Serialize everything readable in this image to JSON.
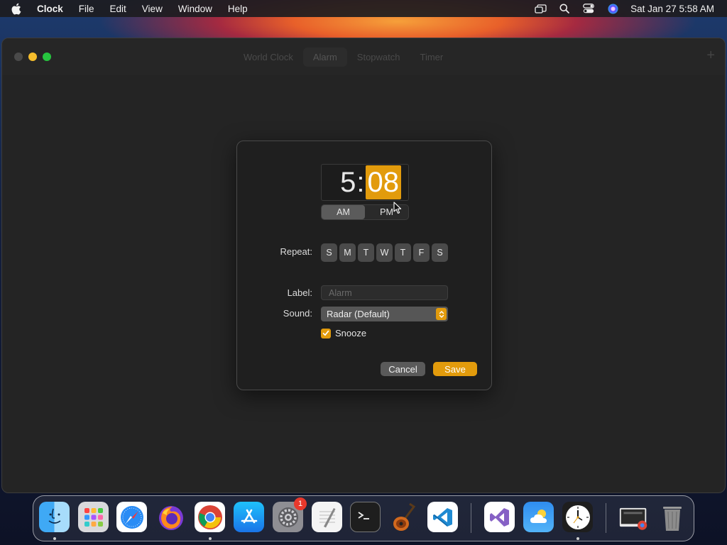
{
  "menubar": {
    "app_name": "Clock",
    "menus": [
      "File",
      "Edit",
      "View",
      "Window",
      "Help"
    ],
    "clock": "Sat Jan 27  5:58 AM"
  },
  "window": {
    "tabs": [
      "World Clock",
      "Alarm",
      "Stopwatch",
      "Timer"
    ],
    "active_tab": "Alarm",
    "add_label": "+"
  },
  "dialog": {
    "time": {
      "hours": "5",
      "separator": ":",
      "minutes": "08"
    },
    "ampm": {
      "am": "AM",
      "pm": "PM",
      "selected": "AM"
    },
    "repeat": {
      "label": "Repeat:",
      "days": [
        "S",
        "M",
        "T",
        "W",
        "T",
        "F",
        "S"
      ]
    },
    "label_field": {
      "label": "Label:",
      "value": "",
      "placeholder": "Alarm"
    },
    "sound": {
      "label": "Sound:",
      "value": "Radar (Default)"
    },
    "snooze": {
      "label": "Snooze",
      "checked": true
    },
    "buttons": {
      "cancel": "Cancel",
      "save": "Save"
    }
  },
  "dock": {
    "apps": [
      "Finder",
      "Launchpad",
      "Safari",
      "Firefox",
      "Google Chrome",
      "App Store",
      "System Settings",
      "TextEdit",
      "Terminal",
      "GarageBand",
      "Visual Studio Code",
      "Visual Studio",
      "Weather",
      "Clock",
      "Downloads",
      "Trash"
    ],
    "settings_badge": "1"
  },
  "colors": {
    "accent": "#e29b0c",
    "window_bg": "#242424",
    "dialog_bg": "#1f1f1f"
  }
}
